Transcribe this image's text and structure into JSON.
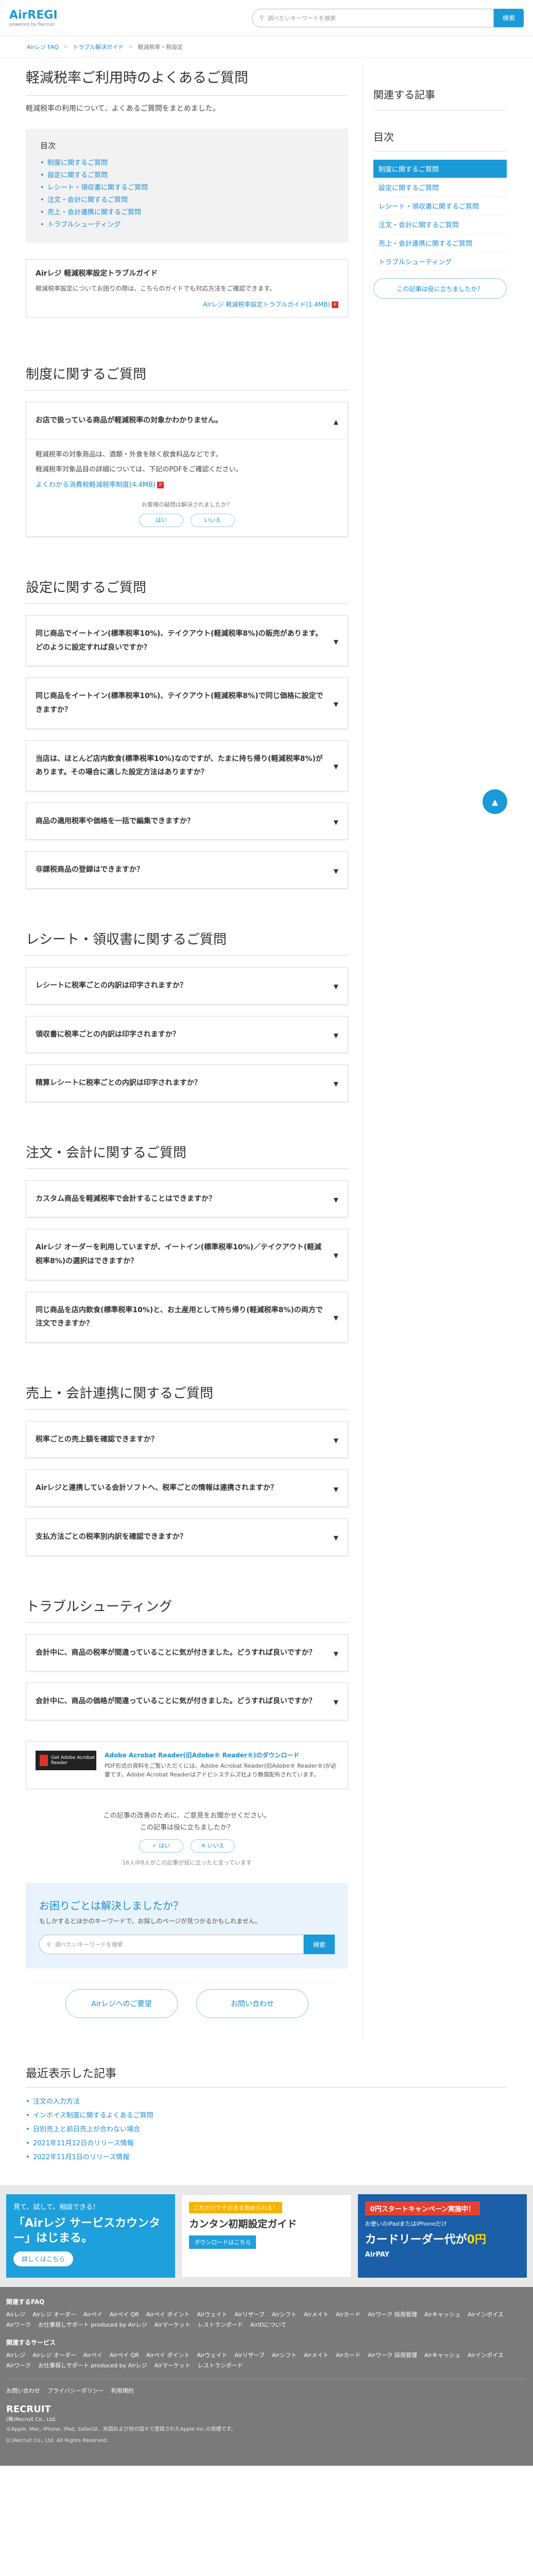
{
  "header": {
    "logo": "AirREGI",
    "logo_sub": "powered by Recruit",
    "search_placeholder": "調べたいキーワードを検索",
    "search_button": "検索"
  },
  "breadcrumb": [
    "Airレジ FAQ",
    "トラブル解決ガイド",
    "軽減税率・税設定"
  ],
  "page_title": "軽減税率ご利用時のよくあるご質問",
  "lead": "軽減税率の利用について、よくあるご質問をまとめました。",
  "toc": {
    "title": "目次",
    "items": [
      "制度に関するご質問",
      "設定に関するご質問",
      "レシート・領収書に関するご質問",
      "注文・会計に関するご質問",
      "売上・会計連携に関するご質問",
      "トラブルシューティング"
    ]
  },
  "guide": {
    "title": "Airレジ 軽減税率設定トラブルガイド",
    "text": "軽減税率設定についてお困りの際は、こちらのガイドでも対応方法をご確認できます。",
    "link": "Airレジ 軽減税率設定トラブルガイド(1.4MB)"
  },
  "sections": [
    {
      "title": "制度に関するご質問",
      "faqs": [
        {
          "q": "お店で扱っている商品が軽減税率の対象かわかりません。",
          "open": true,
          "a1": "軽減税率の対象商品は、酒類・外食を除く飲食料品などです。",
          "a2": "軽減税率対象品目の詳細については、下記のPDFをご確認ください。",
          "link": "よくわかる消費税軽減税率制度(4.4MB)",
          "fb_q": "お客様の疑問は解決されましたか？",
          "fb_yes": "はい",
          "fb_no": "いいえ"
        }
      ]
    },
    {
      "title": "設定に関するご質問",
      "faqs": [
        {
          "q": "同じ商品でイートイン(標準税率10%)、テイクアウト(軽減税率8%)の販売があります。どのように設定すれば良いですか？"
        },
        {
          "q": "同じ商品をイートイン(標準税率10%)、テイクアウト(軽減税率8%)で同じ価格に設定できますか？"
        },
        {
          "q": "当店は、ほとんど店内飲食(標準税率10%)なのですが、たまに持ち帰り(軽減税率8%)があります。その場合に適した設定方法はありますか？"
        },
        {
          "q": "商品の適用税率や価格を一括で編集できますか？"
        },
        {
          "q": "非課税商品の登録はできますか？"
        }
      ]
    },
    {
      "title": "レシート・領収書に関するご質問",
      "faqs": [
        {
          "q": "レシートに税率ごとの内訳は印字されますか？"
        },
        {
          "q": "領収書に税率ごとの内訳は印字されますか？"
        },
        {
          "q": "精算レシートに税率ごとの内訳は印字されますか？"
        }
      ]
    },
    {
      "title": "注文・会計に関するご質問",
      "faqs": [
        {
          "q": "カスタム商品を軽減税率で会計することはできますか？"
        },
        {
          "q": "Airレジ オーダーを利用していますが、イートイン(標準税率10%)／テイクアウト(軽減税率8%)の選択はできますか？"
        },
        {
          "q": "同じ商品を店内飲食(標準税率10%)と、お土産用として持ち帰り(軽減税率8%)の両方で注文できますか？"
        }
      ]
    },
    {
      "title": "売上・会計連携に関するご質問",
      "faqs": [
        {
          "q": "税率ごとの売上額を確認できますか？"
        },
        {
          "q": "Airレジと連携している会計ソフトへ、税率ごとの情報は連携されますか？"
        },
        {
          "q": "支払方法ごとの税率別内訳を確認できますか？"
        }
      ]
    },
    {
      "title": "トラブルシューティング",
      "faqs": [
        {
          "q": "会計中に、商品の税率が間違っていることに気が付きました。どうすれば良いですか？"
        },
        {
          "q": "会計中に、商品の価格が間違っていることに気が付きました。どうすれば良いですか？"
        }
      ]
    }
  ],
  "adobe": {
    "badge": "Get Adobe Acrobat Reader",
    "title": "Adobe Acrobat Reader(旧Adobe® Reader®)のダウンロード",
    "text": "PDF形式の資料をご覧いただくには、Adobe Acrobat Reader(旧Adobe® Reader®)が必要です。Adobe Acrobat Readerはアドビシステムズ社より無償配布されています。"
  },
  "page_feedback": {
    "q1": "この記事の改善のために、ご意見をお聞かせください。",
    "q2": "この記事は役に立ちましたか？",
    "yes": "はい",
    "no": "いいえ",
    "count": "16人中8人がこの記事が役に立ったと言っています"
  },
  "help": {
    "title": "お困りごとは解決しましたか？",
    "text": "もしかするとほかのキーワードで、お探しのページが見つかるかもしれません。",
    "placeholder": "調べたいキーワードを検索",
    "button": "検索"
  },
  "contact": [
    "Airレジへのご要望",
    "お問い合わせ"
  ],
  "sidebar": {
    "related_title": "関連する記事",
    "toc_title": "目次",
    "toc_items": [
      "制度に関するご質問",
      "設定に関するご質問",
      "レシート・領収書に関するご質問",
      "注文・会計に関するご質問",
      "売上・会計連携に関するご質問",
      "トラブルシューティング"
    ],
    "feedback": "この記事は役に立ちましたか？"
  },
  "recent": {
    "title": "最近表示した記事",
    "items": [
      "注文の入力方法",
      "インボイス制度に関するよくあるご質問",
      "日別売上と前日売上が合わない場合",
      "2021年11月12日のリリース情報",
      "2022年11月1日のリリース情報"
    ]
  },
  "banners": {
    "b1_top": "見て、試して、相談できる！",
    "b1_big": "「Airレジ サービスカウンター」はじまる。",
    "b1_btn": "詳しくはこちら",
    "b2_tag": "これだけでそのまま始められる！",
    "b2_big": "カンタン初期設定ガイド",
    "b2_btn": "ダウンロードはこちら",
    "b3_tag": "0円スタートキャンペーン実施中！",
    "b3_sub": "お使いのiPadまたはiPhoneだけ",
    "b3_big": "カードリーダー代が",
    "b3_yen": "0円",
    "b3_logo": "AirPAY"
  },
  "footer": {
    "faq_title": "関連するFAQ",
    "faq_links": [
      "Airレジ",
      "Airレジ オーダー",
      "Airペイ",
      "Airペイ QR",
      "Airペイ ポイント",
      "Airウェイト",
      "Airリザーブ",
      "Airシフト",
      "Airメイト",
      "Airカード",
      "Airワーク 採用管理",
      "Airキャッシュ",
      "Airインボイス",
      "Airワーク",
      "お仕事探しサポート produced by Airレジ",
      "Airマーケット",
      "レストランボード",
      "AirIDについて"
    ],
    "svc_title": "関連するサービス",
    "svc_links": [
      "Airレジ",
      "Airレジ オーダー",
      "Airペイ",
      "Airペイ QR",
      "Airペイ ポイント",
      "Airウェイト",
      "Airリザーブ",
      "Airシフト",
      "Airメイト",
      "Airカード",
      "Airワーク 採用管理",
      "Airキャッシュ",
      "Airインボイス",
      "Airワーク",
      "お仕事探しサポート produced by Airレジ",
      "Airマーケット",
      "レストランボード"
    ],
    "bottom_links": [
      "お問い合わせ",
      "プライバシーポリシー",
      "利用規約"
    ],
    "company": "RECRUIT",
    "company_sub": "(株)Recruit Co., Ltd.",
    "copyright": "©Apple, Mac, iPhone, iPad, Safariは、米国および他の国々で登録されたApple Inc.の商標です。",
    "copyright2": "(C)Recruit Co., Ltd. All Rights Reserved."
  }
}
